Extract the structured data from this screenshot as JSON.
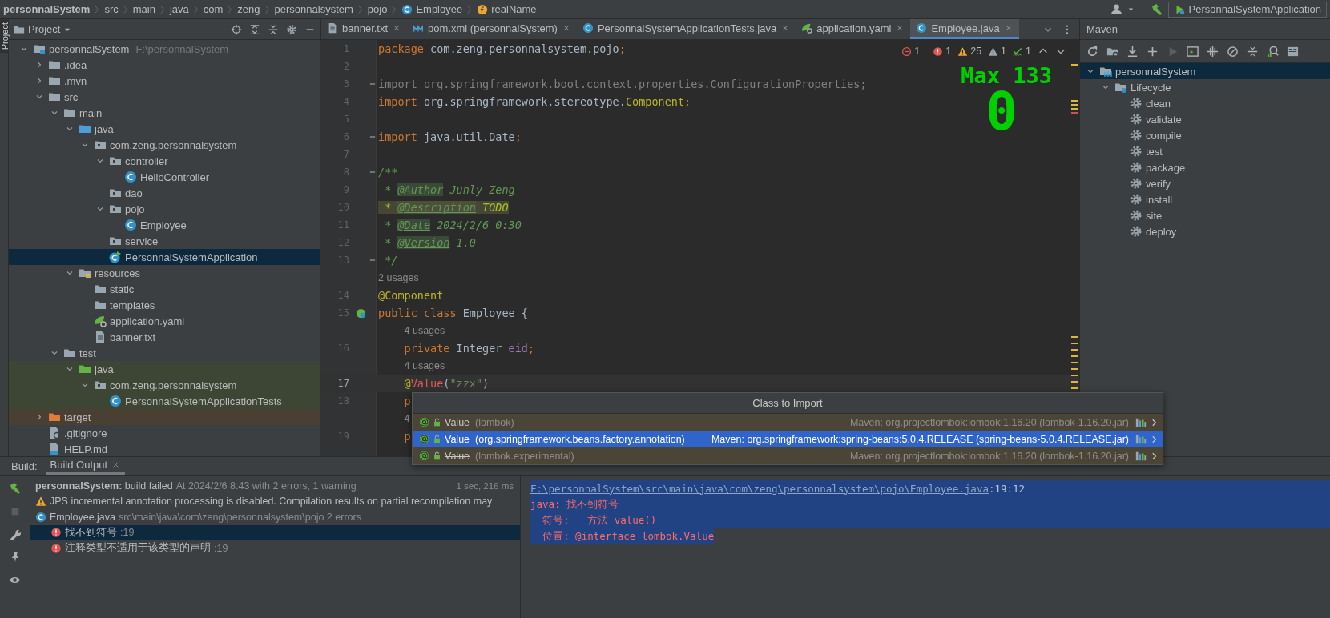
{
  "breadcrumb": [
    {
      "label": "personnalSystem",
      "kind": "project"
    },
    {
      "label": "src",
      "kind": "folder"
    },
    {
      "label": "main",
      "kind": "folder"
    },
    {
      "label": "java",
      "kind": "folder"
    },
    {
      "label": "com",
      "kind": "folder"
    },
    {
      "label": "zeng",
      "kind": "folder"
    },
    {
      "label": "personnalsystem",
      "kind": "folder"
    },
    {
      "label": "pojo",
      "kind": "folder"
    },
    {
      "label": "Employee",
      "kind": "class"
    },
    {
      "label": "realName",
      "kind": "field"
    }
  ],
  "run_config": "PersonnalSystemApplication",
  "tool_stripe": {
    "label": "Project",
    "selected": true
  },
  "project": {
    "title": "Project",
    "tree": [
      {
        "label": "personnalSystem",
        "hint": "F:\\personnalSystem",
        "kind": "module",
        "expanded": true,
        "selected": false,
        "children": [
          {
            "label": ".idea",
            "kind": "folder",
            "expanded": false,
            "selected": false
          },
          {
            "label": ".mvn",
            "kind": "folder",
            "expanded": false,
            "selected": false
          },
          {
            "label": "src",
            "kind": "folder",
            "expanded": true,
            "selected": false,
            "children": [
              {
                "label": "main",
                "kind": "folder",
                "expanded": true,
                "selected": false,
                "children": [
                  {
                    "label": "java",
                    "kind": "source-root",
                    "expanded": true,
                    "selected": false,
                    "children": [
                      {
                        "label": "com.zeng.personnalsystem",
                        "kind": "package",
                        "expanded": true,
                        "selected": false,
                        "children": [
                          {
                            "label": "controller",
                            "kind": "package",
                            "expanded": true,
                            "selected": false,
                            "children": [
                              {
                                "label": "HelloController",
                                "kind": "class",
                                "selected": false
                              }
                            ]
                          },
                          {
                            "label": "dao",
                            "kind": "package",
                            "selected": false
                          },
                          {
                            "label": "pojo",
                            "kind": "package",
                            "expanded": true,
                            "selected": false,
                            "children": [
                              {
                                "label": "Employee",
                                "kind": "class",
                                "selected": false
                              }
                            ]
                          },
                          {
                            "label": "service",
                            "kind": "package",
                            "selected": false
                          },
                          {
                            "label": "PersonnalSystemApplication",
                            "kind": "spring-class",
                            "selected": true
                          }
                        ]
                      }
                    ]
                  },
                  {
                    "label": "resources",
                    "kind": "resources-root",
                    "expanded": true,
                    "selected": false,
                    "children": [
                      {
                        "label": "static",
                        "kind": "folder",
                        "selected": false
                      },
                      {
                        "label": "templates",
                        "kind": "folder",
                        "selected": false
                      },
                      {
                        "label": "application.yaml",
                        "kind": "yaml",
                        "selected": false
                      },
                      {
                        "label": "banner.txt",
                        "kind": "text",
                        "selected": false
                      }
                    ]
                  }
                ]
              },
              {
                "label": "test",
                "kind": "folder",
                "expanded": true,
                "selected": false,
                "children": [
                  {
                    "label": "java",
                    "kind": "test-root",
                    "expanded": true,
                    "selected": false,
                    "children": [
                      {
                        "label": "com.zeng.personnalsystem",
                        "kind": "test-package",
                        "expanded": true,
                        "selected": false,
                        "children": [
                          {
                            "label": "PersonnalSystemApplicationTests",
                            "kind": "test-class",
                            "selected": false
                          }
                        ]
                      }
                    ]
                  }
                ]
              }
            ]
          },
          {
            "label": "target",
            "kind": "excluded-folder",
            "expanded": false,
            "selected": false
          },
          {
            "label": ".gitignore",
            "kind": "gitignore",
            "selected": false
          },
          {
            "label": "HELP.md",
            "kind": "markdown",
            "selected": false
          }
        ]
      }
    ]
  },
  "editor_tabs": [
    {
      "label": "banner.txt",
      "kind": "text",
      "selected": false
    },
    {
      "label": "pom.xml (personnalSystem)",
      "kind": "maven",
      "selected": false
    },
    {
      "label": "PersonnalSystemApplicationTests.java",
      "kind": "class",
      "selected": false
    },
    {
      "label": "application.yaml",
      "kind": "yaml",
      "selected": false
    },
    {
      "label": "Employee.java",
      "kind": "class",
      "selected": true
    }
  ],
  "inspections": [
    {
      "kind": "error-off",
      "count": "1"
    },
    {
      "kind": "error",
      "count": "1"
    },
    {
      "kind": "warning",
      "count": "25"
    },
    {
      "kind": "weak-warning",
      "count": "1"
    },
    {
      "kind": "typo",
      "count": "1"
    }
  ],
  "power_mode": {
    "label": "Max 133",
    "value": "0"
  },
  "code": [
    {
      "kind": "code",
      "number": "1",
      "current": false,
      "tokens": [
        {
          "kind": "keyword",
          "text": "package"
        },
        {
          "kind": "plain",
          "text": " com.zeng.personnalsystem.pojo"
        },
        {
          "kind": "keyword",
          "text": ";"
        }
      ]
    },
    {
      "kind": "code",
      "number": "2",
      "current": false
    },
    {
      "kind": "code",
      "number": "3",
      "current": false,
      "folding": true,
      "tokens": [
        {
          "kind": "unused",
          "text": "import org.springframework.boot.context.properties.ConfigurationProperties;"
        }
      ]
    },
    {
      "kind": "code",
      "number": "4",
      "current": false,
      "tokens": [
        {
          "kind": "keyword",
          "text": "import"
        },
        {
          "kind": "plain",
          "text": " org.springframework.stereotype."
        },
        {
          "kind": "annotation",
          "text": "Component"
        },
        {
          "kind": "keyword",
          "text": ";"
        }
      ]
    },
    {
      "kind": "code",
      "number": "5",
      "current": false
    },
    {
      "kind": "code",
      "number": "6",
      "current": false,
      "folding": true,
      "tokens": [
        {
          "kind": "keyword",
          "text": "import"
        },
        {
          "kind": "plain",
          "text": " java.util.Date"
        },
        {
          "kind": "keyword",
          "text": ";"
        }
      ]
    },
    {
      "kind": "code",
      "number": "7",
      "current": false
    },
    {
      "kind": "code",
      "number": "8",
      "current": false,
      "folding": true,
      "tokens": [
        {
          "kind": "doc",
          "text": "/**"
        }
      ]
    },
    {
      "kind": "code",
      "number": "9",
      "current": false,
      "tokens": [
        {
          "kind": "doc",
          "text": " * "
        },
        {
          "kind": "doctag",
          "text": "@Author"
        },
        {
          "kind": "doc",
          "text": " Junly Zeng"
        }
      ]
    },
    {
      "kind": "code",
      "number": "10",
      "current": false,
      "tokens": [
        {
          "kind": "todo",
          "text": " * "
        },
        {
          "kind": "todotag",
          "text": "@Description"
        },
        {
          "kind": "todo",
          "text": " TODO"
        }
      ]
    },
    {
      "kind": "code",
      "number": "11",
      "current": false,
      "tokens": [
        {
          "kind": "doc",
          "text": " * "
        },
        {
          "kind": "doctag",
          "text": "@Date"
        },
        {
          "kind": "doc",
          "text": " 2024/2/6 0:30"
        }
      ]
    },
    {
      "kind": "code",
      "number": "12",
      "current": false,
      "tokens": [
        {
          "kind": "doc",
          "text": " * "
        },
        {
          "kind": "doctag",
          "text": "@Version"
        },
        {
          "kind": "doc",
          "text": " 1.0"
        }
      ]
    },
    {
      "kind": "code",
      "number": "13",
      "current": false,
      "folding": true,
      "tokens": [
        {
          "kind": "doc",
          "text": " */"
        }
      ]
    },
    {
      "kind": "usage",
      "text": "2 usages"
    },
    {
      "kind": "code",
      "number": "14",
      "current": false,
      "tokens": [
        {
          "kind": "annotation",
          "text": "@Component"
        }
      ]
    },
    {
      "kind": "code",
      "number": "15",
      "current": false,
      "bean_marker": true,
      "tokens": [
        {
          "kind": "keyword",
          "text": "public class "
        },
        {
          "kind": "plain",
          "text": "Employee {"
        }
      ]
    },
    {
      "kind": "usage",
      "text": "4 usages"
    },
    {
      "kind": "code",
      "number": "16",
      "current": false,
      "tokens": [
        {
          "kind": "keyword",
          "text": "    private "
        },
        {
          "kind": "plain",
          "text": "Integer "
        },
        {
          "kind": "field",
          "text": "eid"
        },
        {
          "kind": "keyword",
          "text": ";"
        }
      ]
    },
    {
      "kind": "usage",
      "text": "4 usages"
    },
    {
      "kind": "code",
      "number": "17",
      "current": true,
      "tokens": [
        {
          "kind": "annotation",
          "text": "    @"
        },
        {
          "kind": "error",
          "text": "Value"
        },
        {
          "kind": "plain",
          "text": "("
        },
        {
          "kind": "string",
          "text": "\"zzx\""
        },
        {
          "kind": "plain",
          "text": ")"
        }
      ]
    },
    {
      "kind": "code",
      "number": "18",
      "current": false,
      "tokens": [
        {
          "kind": "keyword",
          "text": "    p"
        }
      ]
    },
    {
      "kind": "usage",
      "text": "4"
    },
    {
      "kind": "code",
      "number": "19",
      "current": false,
      "tokens": [
        {
          "kind": "keyword",
          "text": "    p"
        }
      ]
    }
  ],
  "import_popup": {
    "title": "Class to Import",
    "options": [
      {
        "name": "Value",
        "qualifier": "(lombok)",
        "source": "Maven: org.projectlombok:lombok:1.16.20 (lombok-1.16.20.jar)",
        "selected": false,
        "deprecated": false
      },
      {
        "name": "Value",
        "qualifier": "(org.springframework.beans.factory.annotation)",
        "source": "Maven: org.springframework:spring-beans:5.0.4.RELEASE (spring-beans-5.0.4.RELEASE.jar)",
        "selected": true,
        "deprecated": false
      },
      {
        "name": "Value",
        "qualifier": "(lombok.experimental)",
        "source": "Maven: org.projectlombok:lombok:1.16.20 (lombok-1.16.20.jar)",
        "selected": false,
        "deprecated": true
      }
    ]
  },
  "maven": {
    "title": "Maven",
    "tree": [
      {
        "label": "personnalSystem",
        "kind": "maven-project",
        "expanded": true,
        "selected": true,
        "children": [
          {
            "label": "Lifecycle",
            "kind": "lifecycle",
            "expanded": true,
            "selected": false,
            "children": [
              {
                "label": "clean",
                "kind": "goal",
                "selected": false
              },
              {
                "label": "validate",
                "kind": "goal",
                "selected": false
              },
              {
                "label": "compile",
                "kind": "goal",
                "selected": false
              },
              {
                "label": "test",
                "kind": "goal",
                "selected": false
              },
              {
                "label": "package",
                "kind": "goal",
                "selected": false
              },
              {
                "label": "verify",
                "kind": "goal",
                "selected": false
              },
              {
                "label": "install",
                "kind": "goal",
                "selected": false
              },
              {
                "label": "site",
                "kind": "goal",
                "selected": false
              },
              {
                "label": "deploy",
                "kind": "goal",
                "selected": false
              }
            ]
          }
        ]
      }
    ]
  },
  "build": {
    "label": "Build:",
    "tabs": [
      {
        "label": "Build Output",
        "selected": true
      }
    ],
    "tree": [
      {
        "kind": "result",
        "text": "**personnalSystem:** build failed",
        "detail": "At 2024/2/6 8:43 with 2 errors, 1 warning",
        "time": "1 sec, 216 ms",
        "selected": false
      },
      {
        "kind": "warning",
        "text": "JPS incremental annotation processing is disabled. Compilation results on partial recompilation may",
        "selected": false
      },
      {
        "kind": "file",
        "text": "Employee.java",
        "detail": "src\\main\\java\\com\\zeng\\personnalsystem\\pojo 2 errors",
        "selected": false,
        "children": [
          {
            "kind": "error",
            "text": "找不到符号",
            "detail": ":19",
            "selected": true
          },
          {
            "kind": "error",
            "text": "注释类型不适用于该类型的声明",
            "detail": ":19",
            "selected": false
          }
        ]
      }
    ],
    "console": [
      {
        "kind": "link",
        "text": "F:\\personnalSystem\\src\\main\\java\\com\\zeng\\personnalsystem\\pojo\\Employee.java",
        "suffix": ":19:12",
        "selected": true
      },
      {
        "kind": "error",
        "text": "java: 找不到符号",
        "selected": true
      },
      {
        "kind": "error",
        "text": "  符号:   方法 value()",
        "selected": true
      },
      {
        "kind": "error",
        "text": "  位置: @interface lombok.Value",
        "selected": true
      }
    ]
  }
}
